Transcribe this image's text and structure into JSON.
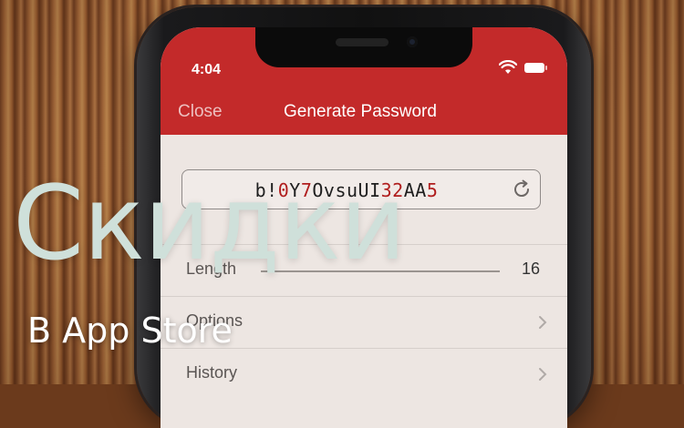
{
  "status_bar": {
    "time": "4:04"
  },
  "navbar": {
    "close_label": "Close",
    "title": "Generate Password",
    "color": "#c32a2a"
  },
  "password": {
    "segments": [
      {
        "text": "b!",
        "digit": false
      },
      {
        "text": "0",
        "digit": true
      },
      {
        "text": "Y",
        "digit": false
      },
      {
        "text": "7",
        "digit": true
      },
      {
        "text": "OvsuUI",
        "digit": false
      },
      {
        "text": "32",
        "digit": true
      },
      {
        "text": "AA",
        "digit": false
      },
      {
        "text": "5",
        "digit": true
      }
    ],
    "digit_color": "#b01e1e",
    "refresh_icon": "refresh-icon"
  },
  "settings": {
    "length": {
      "label": "Length",
      "value": "16"
    },
    "options": {
      "label": "Options"
    },
    "history": {
      "label": "History"
    }
  },
  "overlay": {
    "title": "Скидки",
    "subtitle": "В App Store"
  }
}
